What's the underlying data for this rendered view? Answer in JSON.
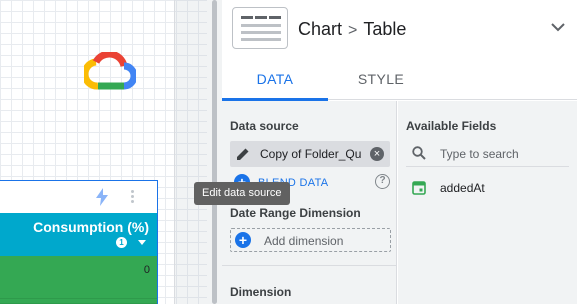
{
  "canvas": {
    "logo": "google-cloud-logo",
    "table": {
      "column_header": "Consumption (%)",
      "sort_order": "1",
      "rows": [
        {
          "value": "0"
        }
      ]
    }
  },
  "panel": {
    "header": {
      "breadcrumb_root": "Chart",
      "separator": ">",
      "breadcrumb_current": "Table"
    },
    "tabs": [
      {
        "label": "DATA",
        "active": true
      },
      {
        "label": "STYLE",
        "active": false
      }
    ],
    "data_source": {
      "section_label": "Data source",
      "name": "Copy of Folder_Qu",
      "blend_label": "BLEND DATA"
    },
    "date_range": {
      "section_label": "Date Range Dimension",
      "add_label": "Add dimension"
    },
    "dimension": {
      "section_label": "Dimension"
    },
    "available_fields": {
      "section_label": "Available Fields",
      "search_placeholder": "Type to search",
      "fields": [
        {
          "name": "addedAt",
          "icon": "calendar-icon"
        }
      ]
    }
  },
  "tooltip": {
    "text": "Edit data source"
  },
  "colors": {
    "accent": "#1a73e8",
    "table_header": "#00a8cc",
    "table_cell": "#34a853",
    "tooltip_bg": "#616161"
  }
}
